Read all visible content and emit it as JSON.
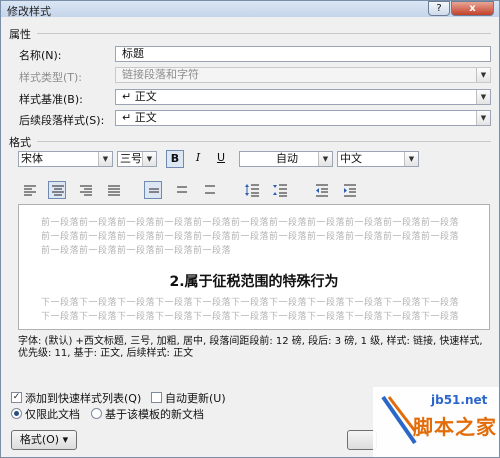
{
  "window": {
    "title": "修改样式",
    "help_glyph": "?",
    "close_glyph": "x"
  },
  "properties": {
    "section_title": "属性",
    "name_label": "名称(N):",
    "name_value": "标题",
    "type_label": "样式类型(T):",
    "type_value": "链接段落和字符",
    "based_label": "样式基准(B):",
    "based_value": "↵ 正文",
    "next_label": "后续段落样式(S):",
    "next_value": "↵ 正文"
  },
  "format": {
    "section_title": "格式",
    "font": "宋体",
    "size": "三号",
    "bold": "B",
    "italic": "I",
    "underline": "U",
    "color": "自动",
    "script": "中文"
  },
  "preview": {
    "prev_line": "前一段落前一段落前一段落前一段落前一段落前一段落前一段落前一段落前一段落前一段落前一段落",
    "prev_line_short": "前一段落前一段落前一段落前一段落前一段落",
    "heading": "2.属于征税范围的特殊行为",
    "next_line": "下一段落下一段落下一段落下一段落下一段落下一段落下一段落下一段落下一段落下一段落下一段落"
  },
  "description": "字体: (默认) +西文标题, 三号, 加粗, 居中, 段落间距段前: 12 磅, 段后: 3 磅, 1 级, 样式: 链接, 快速样式, 优先级: 11, 基于: 正文, 后续样式: 正文",
  "options": {
    "add_quick": "添加到快速样式列表(Q)",
    "auto_update": "自动更新(U)",
    "only_doc": "仅限此文档",
    "template_docs": "基于该模板的新文档"
  },
  "buttons": {
    "format_menu": "格式(O) ▾"
  },
  "watermark": {
    "url": "jb51.net",
    "name": "脚本之家"
  }
}
